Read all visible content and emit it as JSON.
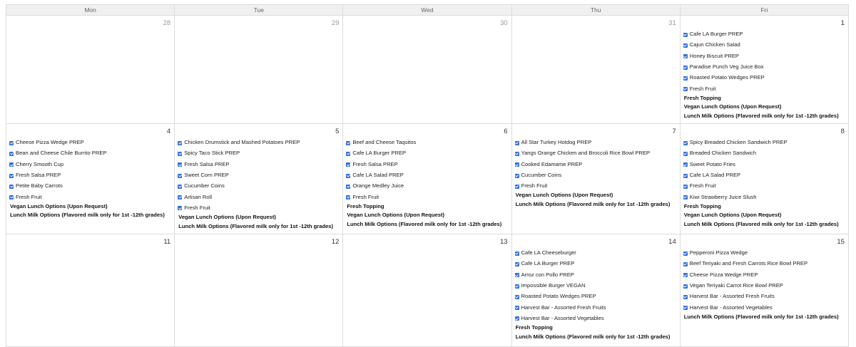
{
  "weekdays": [
    "Mon",
    "Tue",
    "Wed",
    "Thu",
    "Fri"
  ],
  "weeks": [
    {
      "days": [
        {
          "date": "28",
          "other_month": true,
          "items": [],
          "notes": []
        },
        {
          "date": "29",
          "other_month": true,
          "items": [],
          "notes": []
        },
        {
          "date": "30",
          "other_month": true,
          "items": [],
          "notes": []
        },
        {
          "date": "31",
          "other_month": true,
          "items": [],
          "notes": []
        },
        {
          "date": "1",
          "other_month": false,
          "items": [
            "Cafe LA Burger PREP",
            "Cajun Chicken Salad",
            "Honey Biscuit PREP",
            "Paradise Punch Veg Juice Box",
            "Roasted Potato Wedges PREP",
            "Fresh Fruit"
          ],
          "notes": [
            "Fresh Topping",
            "Vegan Lunch Options (Upon Request)",
            "Lunch Milk Options (Flavored milk only for 1st -12th grades)"
          ]
        }
      ]
    },
    {
      "days": [
        {
          "date": "4",
          "other_month": false,
          "items": [
            "Cheese Pizza Wedge PREP",
            "Bean and Cheese Chile Burrito PREP",
            "Cherry Smooth Cup",
            "Fresh Salsa PREP",
            "Petite Baby Carrots",
            "Fresh Fruit"
          ],
          "notes": [
            "Vegan Lunch Options (Upon Request)",
            "Lunch Milk Options (Flavored milk only for 1st -12th grades)"
          ]
        },
        {
          "date": "5",
          "other_month": false,
          "items": [
            "Chicken Drumstick and Mashed Potatoes PREP",
            "Spicy Taco Stick PREP",
            "Fresh Salsa PREP",
            "Sweet Corn PREP",
            "Cucumber Coins",
            "Artisan Roll",
            "Fresh Fruit"
          ],
          "notes": [
            "Vegan Lunch Options (Upon Request)",
            "Lunch Milk Options (Flavored milk only for 1st -12th grades)"
          ]
        },
        {
          "date": "6",
          "other_month": false,
          "items": [
            "Beef and Cheese Taquitos",
            "Cafe LA Burger PREP",
            "Fresh Salsa PREP",
            "Cafe LA Salad PREP",
            "Orange Medley Juice",
            "Fresh Fruit"
          ],
          "notes": [
            "Fresh Topping",
            "Vegan Lunch Options (Upon Request)",
            "Lunch Milk Options (Flavored milk only for 1st -12th grades)"
          ]
        },
        {
          "date": "7",
          "other_month": false,
          "items": [
            "All Star Turkey Hotdog PREP",
            "Yangs Orange Chicken and Broccoli Rice Bowl PREP",
            "Cooked Edamame PREP",
            "Cucumber Coins",
            "Fresh Fruit"
          ],
          "notes": [
            "Vegan Lunch Options (Upon Request)",
            "Lunch Milk Options (Flavored milk only for 1st -12th grades)"
          ]
        },
        {
          "date": "8",
          "other_month": false,
          "items": [
            "Spicy Breaded Chicken Sandwich PREP",
            "Breaded Chicken Sandwich",
            "Sweet Potato Fries",
            "Cafe LA Salad PREP",
            "Fresh Fruit",
            "Kiwi Strawberry Juice Slush"
          ],
          "notes": [
            "Fresh Topping",
            "Vegan Lunch Options (Upon Request)",
            "Lunch Milk Options (Flavored milk only for 1st -12th grades)"
          ]
        }
      ]
    },
    {
      "days": [
        {
          "date": "11",
          "other_month": false,
          "items": [],
          "notes": []
        },
        {
          "date": "12",
          "other_month": false,
          "items": [],
          "notes": []
        },
        {
          "date": "13",
          "other_month": false,
          "items": [],
          "notes": []
        },
        {
          "date": "14",
          "other_month": false,
          "items": [
            "Cafe LA Cheeseburger",
            "Cafe LA Burger PREP",
            "Arroz con Pollo PREP",
            "Impossible Burger VEGAN",
            "Roasted Potato Wedges PREP",
            "Harvest Bar - Assorted Fresh Fruits",
            "Harvest Bar - Assorted Vegetables"
          ],
          "notes": [
            "Fresh Topping",
            "Lunch Milk Options (Flavored milk only for 1st -12th grades)"
          ]
        },
        {
          "date": "15",
          "other_month": false,
          "items": [
            "Pepperoni Pizza Wedge",
            "Beef Teriyaki and Fresh Carrots Rice Bowl PREP",
            "Cheese Pizza Wedge PREP",
            "Vegan Teriyaki Carrot Rice Bowl PREP",
            "Harvest Bar - Assorted Fresh Fruits",
            "Harvest Bar - Assorted Vegetables"
          ],
          "notes": [
            "Lunch Milk Options (Flavored milk only for 1st -12th grades)"
          ]
        }
      ]
    }
  ],
  "colors": {
    "checkbox": "#2f6fdc",
    "header_bg": "#f0f0f0",
    "grid_line": "#dcdcdc"
  }
}
